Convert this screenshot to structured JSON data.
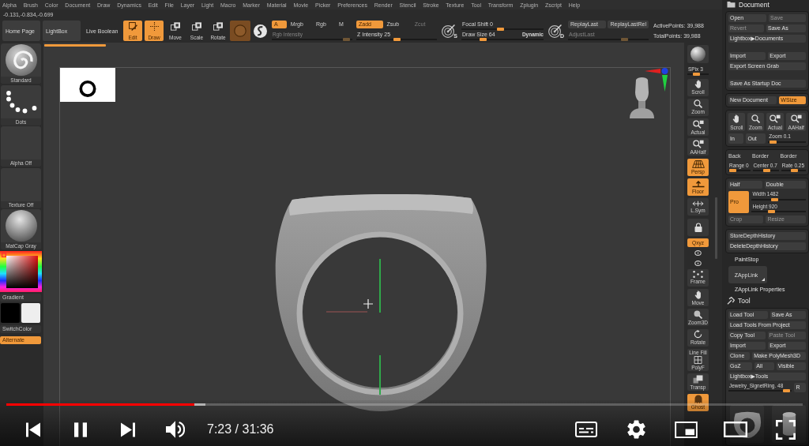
{
  "menu_bar": {
    "items": [
      "Alpha",
      "Brush",
      "Color",
      "Document",
      "Draw",
      "Dynamics",
      "Edit",
      "File",
      "Layer",
      "Light",
      "Macro",
      "Marker",
      "Material",
      "Movie",
      "Picker",
      "Preferences",
      "Render",
      "Stencil",
      "Stroke",
      "Texture",
      "Tool",
      "Transform",
      "Zplugin",
      "Zscript",
      "Help"
    ]
  },
  "coordinates": "-0.131,-0.834,-0.699",
  "shelf": {
    "nav_buttons": [
      {
        "kind": "button",
        "label": "Home Page"
      },
      {
        "kind": "button",
        "label": "LightBox"
      },
      {
        "kind": "toggle",
        "label": "Live Boolean",
        "on": false
      }
    ],
    "tools": [
      {
        "label": "Edit",
        "selected": true
      },
      {
        "label": "Draw",
        "selected": true
      },
      {
        "label": "Move",
        "selected": false
      },
      {
        "label": "Scale",
        "selected": false
      },
      {
        "label": "Rotate",
        "selected": false
      }
    ],
    "color_modes": [
      {
        "label": "A",
        "selected": true
      },
      {
        "label": "Mrgb",
        "selected": false
      },
      {
        "label": "Rgb",
        "selected": false
      },
      {
        "label": "M",
        "selected": false
      }
    ],
    "rgb_intensity": {
      "label": "Rgb Intensity",
      "disabled": true,
      "level": 0.97
    },
    "z_modes": [
      {
        "label": "Zadd",
        "selected": true,
        "disabled": false
      },
      {
        "label": "Zsub",
        "selected": false,
        "disabled": false
      },
      {
        "label": "Zcut",
        "selected": false,
        "disabled": true
      }
    ],
    "z_intensity": {
      "label": "Z Intensity",
      "value": "25",
      "level": 0.5
    },
    "stroke": {
      "badge": "S",
      "sliders": [
        {
          "label": "Focal Shift",
          "value": "0",
          "level": 0.47
        },
        {
          "label": "Draw Size",
          "value": "64",
          "level": 0.24,
          "note": "Dynamic"
        }
      ]
    },
    "replay": {
      "badge": "D",
      "buttons": [
        {
          "label": "ReplayLast"
        },
        {
          "label": "ReplayLastRel"
        }
      ],
      "adjust_last": {
        "label": "AdjustLast",
        "disabled": true,
        "level": 0.72
      }
    },
    "stats": [
      {
        "label": "ActivePoints:",
        "value": "39,988"
      },
      {
        "label": "TotalPoints:",
        "value": "39,988"
      }
    ]
  },
  "left_palette": {
    "tiles": [
      {
        "label": "Standard"
      },
      {
        "label": "Dots"
      },
      {
        "label": "Alpha Off"
      },
      {
        "label": "Texture Off"
      },
      {
        "label": "MatCap Gray"
      }
    ],
    "gradient_label": "Gradient",
    "swatches": [
      {
        "color": "#000000"
      },
      {
        "color": "#eeeeee"
      }
    ],
    "switch_color": "SwitchColor",
    "alternate": {
      "label": "Alternate",
      "selected": true
    }
  },
  "right_shelf": [
    {
      "kind": "render"
    },
    {
      "kind": "slider",
      "label": "SPix",
      "value": "3",
      "level": 0.4
    },
    {
      "kind": "tool",
      "label": "Scroll",
      "selected": false
    },
    {
      "kind": "tool",
      "label": "Zoom",
      "selected": false
    },
    {
      "kind": "tool",
      "label": "Actual",
      "selected": false
    },
    {
      "kind": "tool",
      "label": "AAHalf",
      "selected": false
    },
    {
      "kind": "tool",
      "label": "Persp",
      "selected": true
    },
    {
      "kind": "tool",
      "label": "Floor",
      "selected": true
    },
    {
      "kind": "tool",
      "label": "L.Sym",
      "selected": false
    },
    {
      "kind": "tool",
      "selected": false
    },
    {
      "kind": "toggle",
      "label": "Qxyz",
      "selected": true
    },
    {
      "kind": "mini"
    },
    {
      "kind": "mini"
    },
    {
      "kind": "tool",
      "label": "Frame",
      "selected": false
    },
    {
      "kind": "tool",
      "label": "Move",
      "selected": false
    },
    {
      "kind": "tool",
      "label": "Zoom3D",
      "selected": false
    },
    {
      "kind": "tool",
      "label": "Rotate",
      "selected": false
    },
    {
      "kind": "tool",
      "caption": "Line Fill",
      "label": "PolyF",
      "selected": false
    },
    {
      "kind": "tool",
      "label": "Transp",
      "selected": false
    },
    {
      "kind": "tool",
      "label": "Ghost",
      "selected": true
    }
  ],
  "document_panel": {
    "title": "Document",
    "groups": [
      {
        "sections": [
          [
            [
              {
                "kind": "button",
                "label": "Open"
              },
              {
                "kind": "button",
                "label": "Save",
                "disabled": true
              }
            ],
            [
              {
                "kind": "button",
                "label": "Revert",
                "disabled": true
              },
              {
                "kind": "button",
                "label": "Save As"
              }
            ],
            [
              {
                "kind": "button",
                "label": "Lightbox▶Documents"
              }
            ]
          ],
          [
            [
              {
                "kind": "button",
                "label": "Import"
              },
              {
                "kind": "button",
                "label": "Export"
              }
            ],
            [
              {
                "kind": "button",
                "label": "Export Screen Grab"
              }
            ]
          ],
          [
            [
              {
                "kind": "button",
                "label": "Save As Startup Doc"
              }
            ]
          ]
        ]
      },
      {
        "sections": [
          [
            [
              {
                "kind": "button",
                "label": "New Document"
              },
              {
                "kind": "toggle",
                "label": "WSize",
                "selected": true
              }
            ]
          ]
        ]
      },
      {
        "sections": [
          [
            [
              {
                "kind": "icon",
                "label": "Scroll"
              },
              {
                "kind": "icon",
                "label": "Zoom"
              },
              {
                "kind": "icon",
                "label": "Actual"
              },
              {
                "kind": "icon",
                "label": "AAHalf"
              }
            ],
            [
              {
                "kind": "button",
                "label": "In"
              },
              {
                "kind": "button",
                "label": "Out"
              },
              {
                "kind": "slider",
                "label": "Zoom",
                "value": "0.1",
                "level": 0.05
              }
            ]
          ]
        ]
      },
      {
        "sections": [
          [
            [
              {
                "kind": "text",
                "label": "Back"
              },
              {
                "kind": "text",
                "label": "Border"
              },
              {
                "kind": "text",
                "label": "Border"
              }
            ],
            [
              {
                "kind": "slider",
                "label": "Range",
                "value": "0",
                "level": 0.05
              },
              {
                "kind": "slider",
                "label": "Center",
                "value": "0.7",
                "level": 0.55
              },
              {
                "kind": "slider",
                "label": "Rate",
                "value": "0.25",
                "level": 0.55
              }
            ]
          ]
        ]
      },
      {
        "sections": [
          [
            [
              {
                "kind": "button",
                "label": "Half"
              },
              {
                "kind": "button",
                "label": "Double"
              }
            ],
            [
              {
                "kind": "toggle",
                "label": "Pro",
                "selected": true
              },
              {
                "kind": "column",
                "cells": [
                  {
                    "kind": "slider",
                    "label": "Width",
                    "value": "1482",
                    "level": 0.42
                  },
                  {
                    "kind": "slider",
                    "label": "Height",
                    "value": "920",
                    "level": 0.34
                  }
                ]
              }
            ],
            [
              {
                "kind": "button",
                "label": "Crop",
                "disabled": true
              },
              {
                "kind": "button",
                "label": "Resize",
                "disabled": true
              }
            ]
          ]
        ]
      },
      {
        "sections": [
          [
            [
              {
                "kind": "button",
                "label": "StoreDepthHistory"
              }
            ],
            [
              {
                "kind": "button",
                "label": "DeleteDepthHistory"
              }
            ]
          ]
        ]
      }
    ],
    "items": [
      {
        "kind": "header",
        "label": "PaintStop"
      },
      {
        "kind": "tile",
        "label": "ZAppLink"
      },
      {
        "kind": "header",
        "label": "ZAppLink Properties"
      }
    ]
  },
  "tool_panel": {
    "title": "Tool",
    "rows": [
      [
        {
          "kind": "button",
          "label": "Load Tool"
        },
        {
          "kind": "button",
          "label": "Save As"
        }
      ],
      [
        {
          "kind": "button",
          "label": "Load Tools From Project"
        }
      ],
      [
        {
          "kind": "button",
          "label": "Copy Tool"
        },
        {
          "kind": "button",
          "label": "Paste Tool",
          "disabled": true
        }
      ],
      [
        {
          "kind": "button",
          "label": "Import"
        },
        {
          "kind": "button",
          "label": "Export"
        }
      ],
      [
        {
          "kind": "button",
          "label": "Clone"
        },
        {
          "kind": "button",
          "label": "Make PolyMesh3D"
        }
      ],
      [
        {
          "kind": "button",
          "label": "GoZ"
        },
        {
          "kind": "button",
          "label": "All"
        },
        {
          "kind": "button",
          "label": "Visible"
        }
      ],
      [
        {
          "kind": "button",
          "label": "Lightbox▶Tools"
        }
      ],
      [
        {
          "kind": "slider",
          "label": "Jewelry_SignetRing.",
          "value": "48",
          "level": 0.97
        },
        {
          "kind": "button",
          "label": "R"
        }
      ]
    ]
  },
  "player": {
    "playing": true,
    "progress": {
      "level": 0.236
    },
    "buffered": {
      "level": 0.25
    },
    "time": "7:23 / 31:36"
  }
}
